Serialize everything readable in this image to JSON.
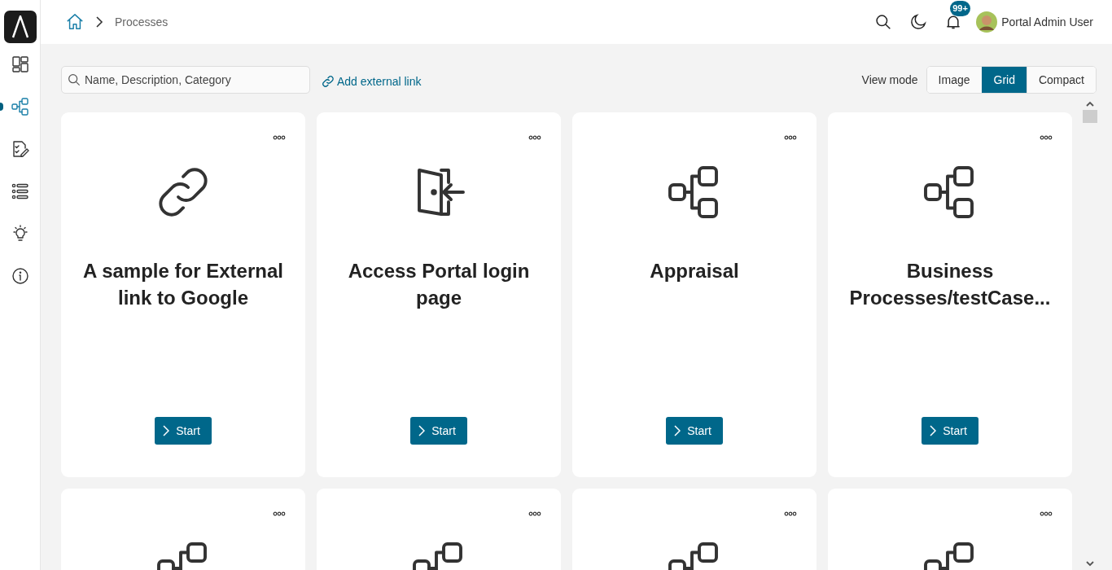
{
  "sidebar": {
    "items": [
      {
        "selected": false
      },
      {
        "selected": true
      },
      {
        "selected": false
      },
      {
        "selected": false
      },
      {
        "selected": false
      },
      {
        "selected": false
      }
    ]
  },
  "breadcrumb": {
    "current": "Processes"
  },
  "header": {
    "notification_badge": "99+",
    "user_name": "Portal Admin User"
  },
  "toolbar": {
    "search": {
      "placeholder": "Name, Description, Category"
    },
    "add_link": "Add external link",
    "view_mode_label": "View mode",
    "view_modes": [
      {
        "label": "Image",
        "selected": false
      },
      {
        "label": "Grid",
        "selected": true
      },
      {
        "label": "Compact",
        "selected": false
      }
    ]
  },
  "cards": [
    {
      "kind": "link",
      "title": "A sample for External link to Google",
      "button": "Start"
    },
    {
      "kind": "portal",
      "title": "Access Portal login page",
      "button": "Start"
    },
    {
      "kind": "process",
      "title": "Appraisal",
      "button": "Start"
    },
    {
      "kind": "process",
      "title": "Business Processes/testCase...",
      "button": "Start"
    },
    {
      "kind": "process"
    },
    {
      "kind": "process"
    },
    {
      "kind": "process"
    },
    {
      "kind": "process"
    }
  ]
}
